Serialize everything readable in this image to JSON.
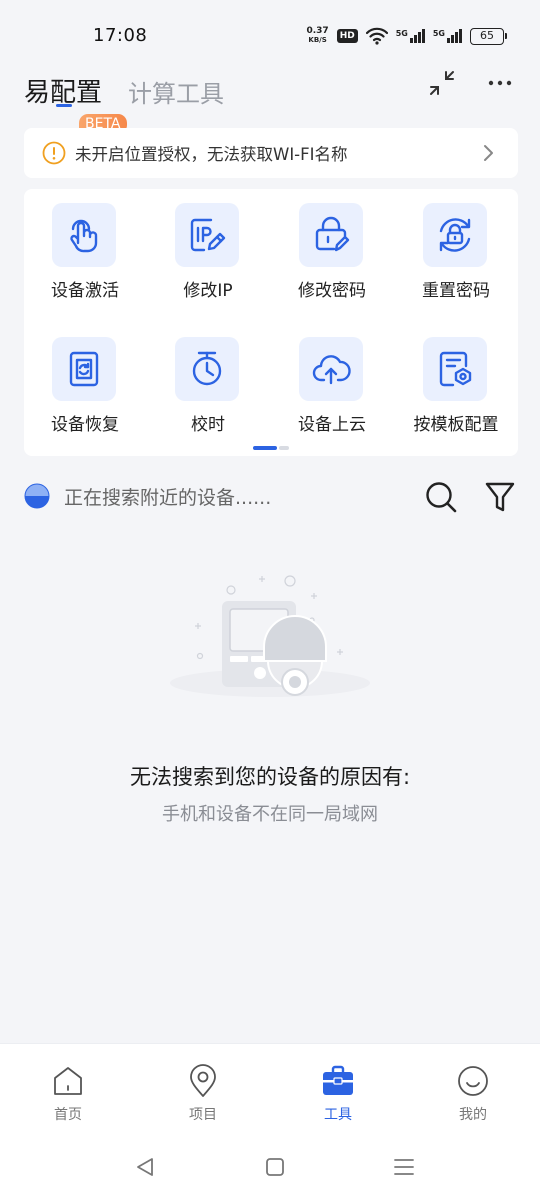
{
  "status_bar": {
    "time": "17:08",
    "net_speed_value": "0.37",
    "net_speed_unit": "KB/S",
    "hd_badge": "HD",
    "signal1_label": "5G",
    "signal2_label": "5G",
    "battery": "65"
  },
  "header": {
    "title": "易配置",
    "beta_badge": "BETA",
    "tab_compute": "计算工具",
    "icons": [
      "collapse-icon",
      "more-icon"
    ]
  },
  "notice": {
    "text": "未开启位置授权，无法获取WI-FI名称",
    "icon": "warning-icon",
    "arrow": "chevron-right-icon"
  },
  "tools": [
    {
      "label": "设备激活",
      "icon": "touch-activate-icon"
    },
    {
      "label": "修改IP",
      "icon": "edit-ip-icon"
    },
    {
      "label": "修改密码",
      "icon": "edit-password-icon"
    },
    {
      "label": "重置密码",
      "icon": "reset-password-icon"
    },
    {
      "label": "设备恢复",
      "icon": "device-restore-icon"
    },
    {
      "label": "校时",
      "icon": "timer-icon"
    },
    {
      "label": "设备上云",
      "icon": "cloud-upload-icon"
    },
    {
      "label": "按模板配置",
      "icon": "template-config-icon"
    }
  ],
  "tools_pager": {
    "page": 1,
    "pages": 2
  },
  "search": {
    "status_text": "正在搜索附近的设备......",
    "icons": [
      "search-icon",
      "filter-icon"
    ]
  },
  "empty_state": {
    "title": "无法搜索到您的设备的原因有:",
    "reason": "手机和设备不在同一局域网"
  },
  "bottom_nav": [
    {
      "label": "首页",
      "icon": "home-icon",
      "active": false
    },
    {
      "label": "项目",
      "icon": "location-pin-icon",
      "active": false
    },
    {
      "label": "工具",
      "icon": "toolbox-icon",
      "active": true
    },
    {
      "label": "我的",
      "icon": "smile-face-icon",
      "active": false
    }
  ],
  "colors": {
    "accent": "#2c63e2",
    "tile_bg": "#eaf0fe",
    "page_bg": "#f4f5f8",
    "beta": "#f6884a",
    "warning": "#f0a020"
  }
}
